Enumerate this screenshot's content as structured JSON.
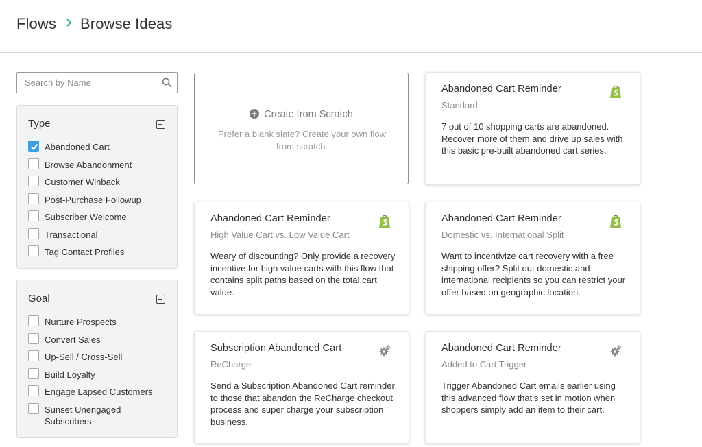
{
  "breadcrumb": {
    "root": "Flows",
    "current": "Browse Ideas",
    "separator_color": "#2bb673"
  },
  "search": {
    "placeholder": "Search by Name",
    "value": ""
  },
  "filters": {
    "type": {
      "title": "Type",
      "options": [
        {
          "label": "Abandoned Cart",
          "checked": true
        },
        {
          "label": "Browse Abandonment",
          "checked": false
        },
        {
          "label": "Customer Winback",
          "checked": false
        },
        {
          "label": "Post-Purchase Followup",
          "checked": false
        },
        {
          "label": "Subscriber Welcome",
          "checked": false
        },
        {
          "label": "Transactional",
          "checked": false
        },
        {
          "label": "Tag Contact Profiles",
          "checked": false
        }
      ]
    },
    "goal": {
      "title": "Goal",
      "options": [
        {
          "label": "Nurture Prospects",
          "checked": false
        },
        {
          "label": "Convert Sales",
          "checked": false
        },
        {
          "label": "Up-Sell / Cross-Sell",
          "checked": false
        },
        {
          "label": "Build Loyalty",
          "checked": false
        },
        {
          "label": "Engage Lapsed Customers",
          "checked": false
        },
        {
          "label": "Sunset Unengaged Subscribers",
          "checked": false
        }
      ]
    }
  },
  "scratch": {
    "title": "Create from Scratch",
    "description": "Prefer a blank slate? Create your own flow from scratch."
  },
  "cards": [
    {
      "title": "Abandoned Cart Reminder",
      "subtitle": "Standard",
      "description": "7 out of 10 shopping carts are abandoned. Recover more of them and drive up sales with this basic pre-built abandoned cart series.",
      "icon": "shopify-icon"
    },
    {
      "title": "Abandoned Cart Reminder",
      "subtitle": "High Value Cart vs. Low Value Cart",
      "description": "Weary of discounting? Only provide a recovery incentive for high value carts with this flow that contains split paths based on the total cart value.",
      "icon": "shopify-icon"
    },
    {
      "title": "Abandoned Cart Reminder",
      "subtitle": "Domestic vs. International Split",
      "description": "Want to incentivize cart recovery with a free shipping offer? Split out domestic and international recipients so you can restrict your offer based on geographic location.",
      "icon": "shopify-icon"
    },
    {
      "title": "Subscription Abandoned Cart",
      "subtitle": "ReCharge",
      "description": "Send a Subscription Abandoned Cart reminder to those that abandon the ReCharge checkout process and super charge your subscription business.",
      "icon": "gear-icon"
    },
    {
      "title": "Abandoned Cart Reminder",
      "subtitle": "Added to Cart Trigger",
      "description": "Trigger Abandoned Cart emails earlier using this advanced flow that's set in motion when shoppers simply add an item to their cart.",
      "icon": "gear-icon"
    }
  ],
  "colors": {
    "checkbox_checked": "#3fa0db",
    "shopify_green": "#95bf47",
    "panel_bg": "#f2f3f4"
  }
}
